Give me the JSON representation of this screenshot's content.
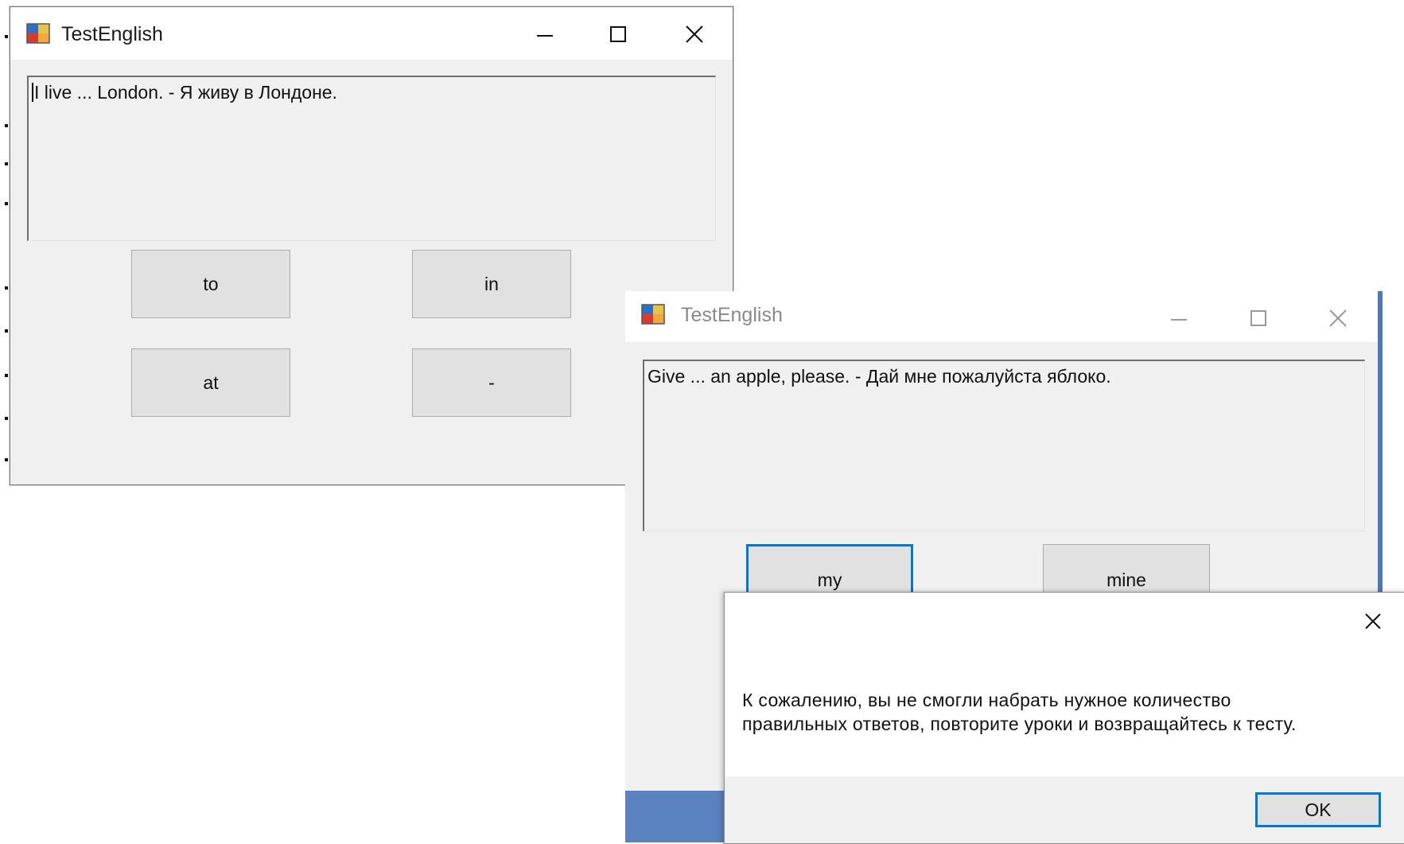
{
  "window1": {
    "title": "TestEnglish",
    "question": "I live ... London. - Я живу в Лондоне.",
    "answers": [
      "to",
      "in",
      "at",
      "-"
    ]
  },
  "window2": {
    "title": "TestEnglish",
    "question": "Give ... an apple, please. - Дай мне пожалуйста яблоко.",
    "answers": [
      "my",
      "mine"
    ]
  },
  "messagebox": {
    "line1": "К сожалению, вы не смогли набрать нужное количество",
    "line2": "правильных ответов, повторите уроки и возвращайтесь к тесту.",
    "ok_label": "OK"
  },
  "icons": {
    "app": "app-icon",
    "minimize": "minimize-icon",
    "maximize": "maximize-icon",
    "close": "close-icon"
  },
  "colors": {
    "focus_accent": "#0078d7",
    "window_bg": "#f0f0f0",
    "button_bg": "#e1e1e1",
    "taskbar": "#5a82bf"
  }
}
